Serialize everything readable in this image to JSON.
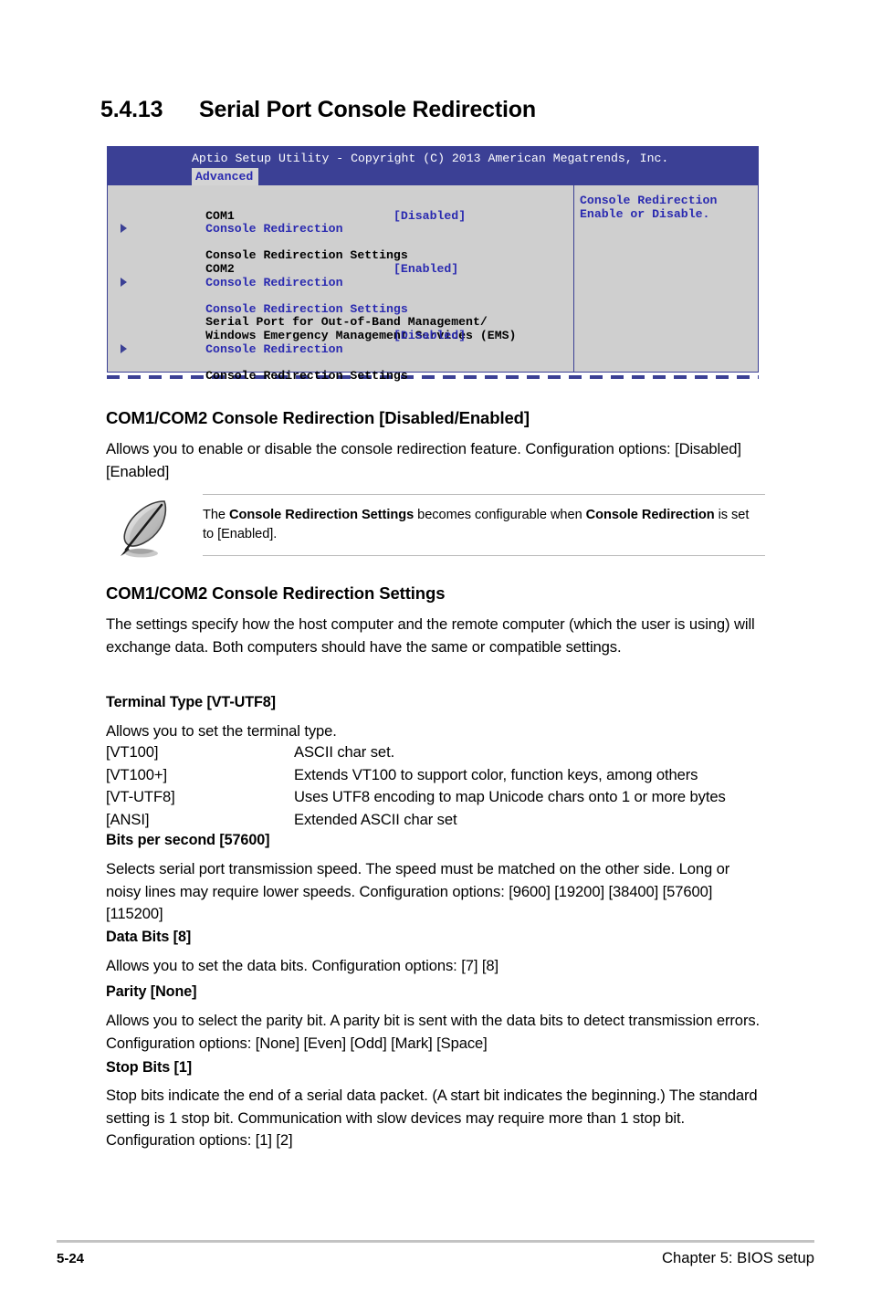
{
  "section": {
    "number": "5.4.13",
    "title": "Serial Port Console Redirection"
  },
  "bios": {
    "titlebar": "Aptio Setup Utility - Copyright (C) 2013 American Megatrends, Inc.",
    "tab": "Advanced",
    "groups": [
      {
        "header": "COM1",
        "rows": [
          {
            "label": "Console Redirection",
            "value": "[Disabled]",
            "arrow": false,
            "label_color": "blue",
            "value_color": "blue"
          },
          {
            "label": "Console Redirection Settings",
            "value": "",
            "arrow": true,
            "label_color": "black",
            "value_color": "black"
          }
        ]
      },
      {
        "header": "COM2",
        "rows": [
          {
            "label": "Console Redirection",
            "value": "[Enabled]",
            "arrow": false,
            "label_color": "blue",
            "value_color": "blue"
          },
          {
            "label": "Console Redirection Settings",
            "value": "",
            "arrow": true,
            "label_color": "blue",
            "value_color": "blue"
          }
        ]
      },
      {
        "header": "Serial Port for Out-of-Band Management/",
        "header2": "Windows Emergency Management Services (EMS)",
        "rows": [
          {
            "label": "Console Redirection",
            "value": "[Disabled]",
            "arrow": false,
            "label_color": "blue",
            "value_color": "blue"
          },
          {
            "label": "Console Redirection Settings",
            "value": "",
            "arrow": true,
            "label_color": "black",
            "value_color": "black"
          }
        ]
      }
    ],
    "help": "Console Redirection\nEnable or Disable.",
    "colors": {
      "titlebar_bg": "#3b4095",
      "panel_bg": "#cfcfcf",
      "accent_blue": "#2a2ab0",
      "border": "#3b4095"
    }
  },
  "content": {
    "heading_1": "COM1/COM2 Console Redirection [Disabled/Enabled]",
    "para_1": "Allows you to enable or disable the console redirection feature. Configuration options: [Disabled] [Enabled]",
    "note": {
      "prefix": "The ",
      "bold_1": "Console Redirection Settings",
      "middle": " becomes configurable when ",
      "bold_2": "Console Redirection",
      "suffix": " is set to [Enabled]."
    },
    "heading_2": "COM1/COM2 Console Redirection Settings",
    "para_2": "The settings specify how the host computer and the remote computer (which the user is using) will exchange data. Both computers should have the same or compatible settings.",
    "terminal_type": {
      "heading": "Terminal Type [VT-UTF8]",
      "intro": "Allows you to set the terminal type.",
      "options": [
        {
          "key": "[VT100]",
          "desc": "ASCII char set."
        },
        {
          "key": "[VT100+]",
          "desc": "Extends VT100 to support color, function keys, among others"
        },
        {
          "key": "[VT-UTF8]",
          "desc": "Uses UTF8 encoding to map Unicode chars onto 1 or more bytes"
        },
        {
          "key": "[ANSI]",
          "desc": "Extended ASCII char set"
        }
      ]
    },
    "bits_per_second": {
      "heading": "Bits per second [57600]",
      "body": "Selects serial port transmission speed. The speed must be matched on the other side. Long or noisy lines may require lower speeds. Configuration options: [9600] [19200] [38400] [57600] [115200]"
    },
    "data_bits": {
      "heading": "Data Bits [8]",
      "body": "Allows you to set the data bits. Configuration options: [7] [8]"
    },
    "parity": {
      "heading": "Parity [None]",
      "body": "Allows you to select the parity bit. A parity bit is sent with the data bits to detect transmission errors. Configuration options: [None] [Even] [Odd] [Mark] [Space]"
    },
    "stop_bits": {
      "heading": "Stop Bits [1]",
      "body": "Stop bits indicate the end of a serial data packet. (A start bit indicates the beginning.) The standard setting is 1 stop bit. Communication with slow devices may require more than 1 stop bit. Configuration options: [1] [2]"
    }
  },
  "footer": {
    "page_number": "5-24",
    "chapter": "Chapter 5: BIOS setup"
  }
}
